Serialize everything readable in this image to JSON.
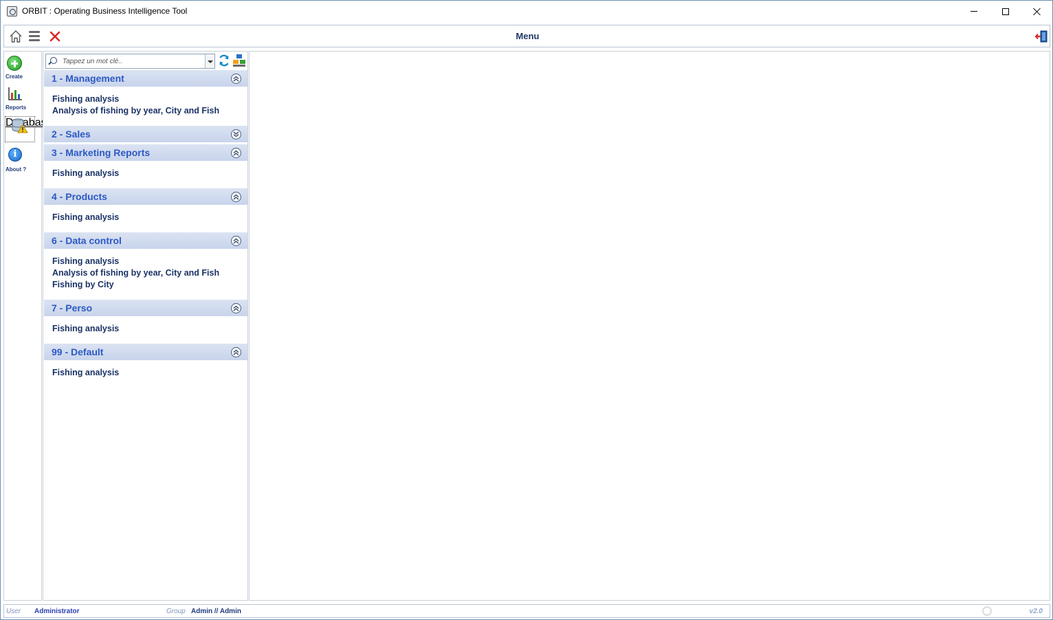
{
  "window": {
    "title": "ORBIT : Operating Business Intelligence Tool"
  },
  "toolbar": {
    "title": "Menu"
  },
  "leftbar": {
    "create": "Create",
    "reports": "Reports",
    "databases": "Databases",
    "about": "About ?"
  },
  "search": {
    "placeholder": "Tappez un mot clé.."
  },
  "groups": [
    {
      "title": "1 - Management",
      "expanded": true,
      "items": [
        "Fishing analysis",
        "Analysis of fishing by year, City and Fish"
      ]
    },
    {
      "title": "2 - Sales",
      "expanded": false,
      "items": []
    },
    {
      "title": "3 - Marketing Reports",
      "expanded": true,
      "items": [
        "Fishing analysis"
      ]
    },
    {
      "title": "4 - Products",
      "expanded": true,
      "items": [
        "Fishing analysis"
      ]
    },
    {
      "title": "6 - Data control",
      "expanded": true,
      "items": [
        "Fishing analysis",
        "Analysis of fishing by year, City and Fish",
        "Fishing by City"
      ]
    },
    {
      "title": "7 - Perso",
      "expanded": true,
      "items": [
        "Fishing analysis"
      ]
    },
    {
      "title": "99 - Default",
      "expanded": true,
      "items": [
        "Fishing analysis"
      ]
    }
  ],
  "status": {
    "user_label": "User",
    "user_value": "Administrator",
    "group_label": "Group",
    "group_value": "Admin // Admin",
    "version": "v2.0"
  },
  "colors": {
    "accent": "#2c59c4",
    "header_bg": "#c8d4ec",
    "item_text": "#1a3264"
  }
}
